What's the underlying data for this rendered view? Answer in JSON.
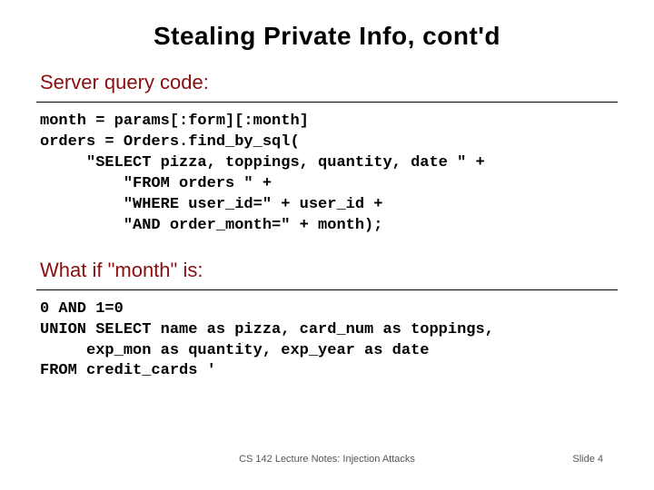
{
  "title": "Stealing Private Info, cont'd",
  "section1": "Server query code:",
  "code1": "month = params[:form][:month]\norders = Orders.find_by_sql(\n     \"SELECT pizza, toppings, quantity, date \" +\n         \"FROM orders \" +\n         \"WHERE user_id=\" + user_id +\n         \"AND order_month=\" + month);",
  "section2": "What if \"month\" is:",
  "code2": "0 AND 1=0\nUNION SELECT name as pizza, card_num as toppings,\n     exp_mon as quantity, exp_year as date\nFROM credit_cards '",
  "footer": {
    "center": "CS 142 Lecture Notes: Injection Attacks",
    "right": "Slide 4"
  }
}
